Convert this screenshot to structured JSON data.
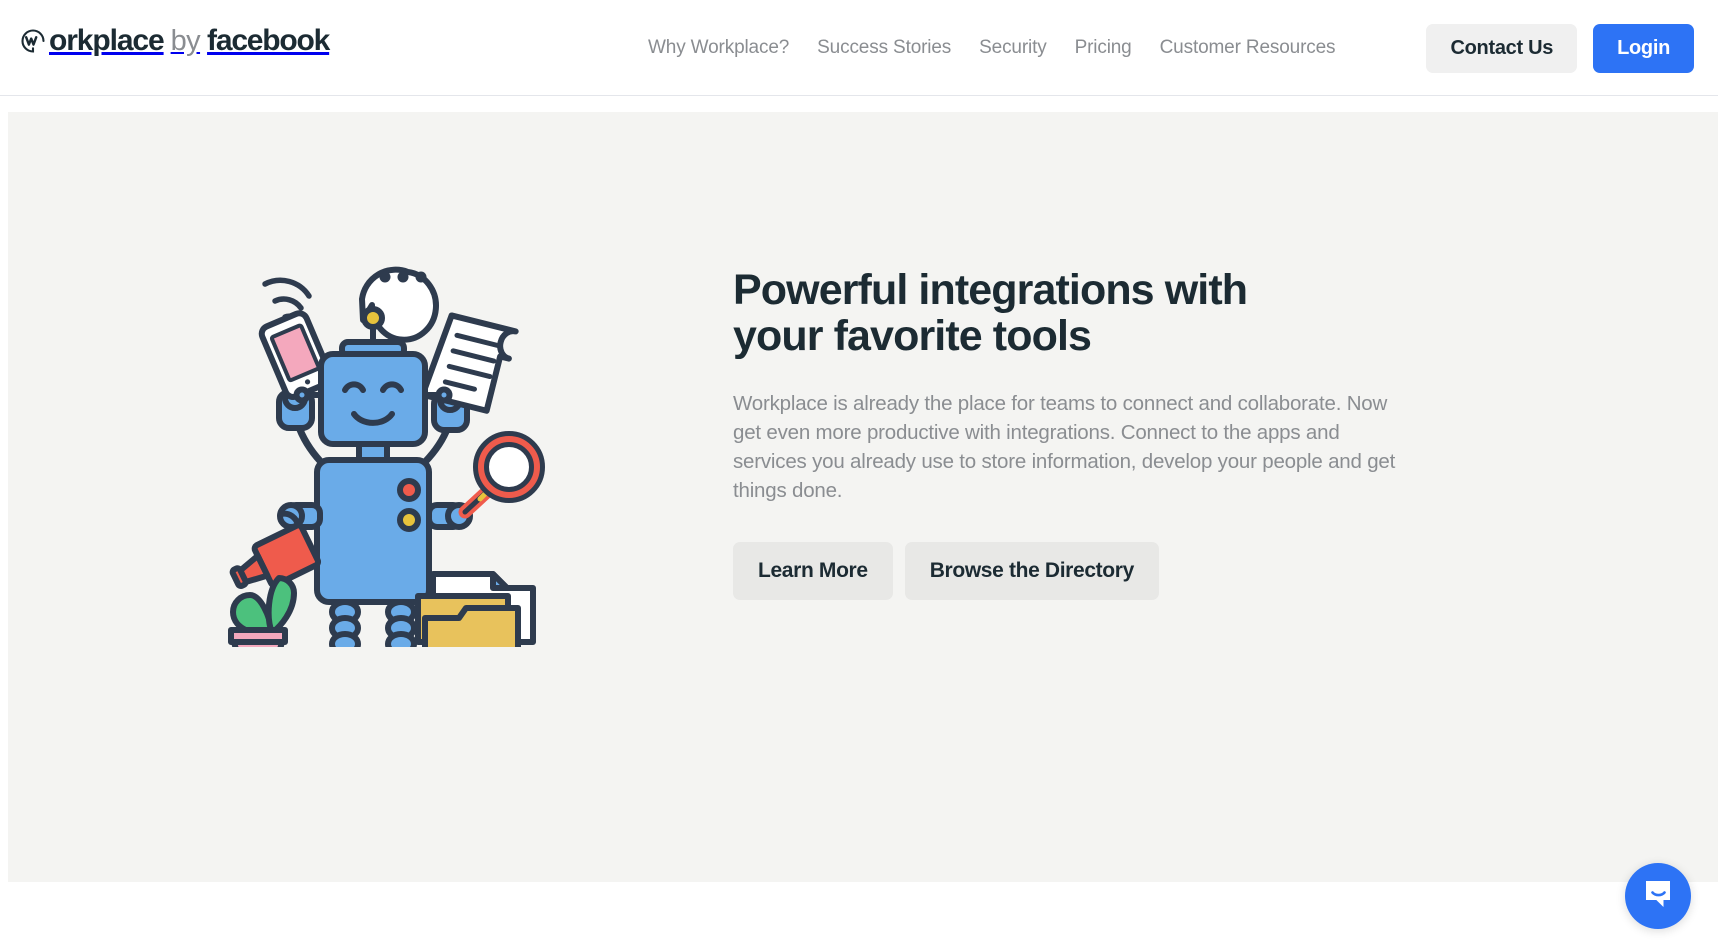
{
  "header": {
    "brand": {
      "logo_icon": "workplace-w-circle-icon",
      "word_workplace": "orkplace",
      "word_by": "by",
      "word_facebook": "facebook",
      "full_text": "Workplace by facebook"
    },
    "nav_items": [
      {
        "label": "Why Workplace?",
        "name": "nav-why-workplace"
      },
      {
        "label": "Success Stories",
        "name": "nav-success-stories"
      },
      {
        "label": "Security",
        "name": "nav-security"
      },
      {
        "label": "Pricing",
        "name": "nav-pricing"
      },
      {
        "label": "Customer Resources",
        "name": "nav-customer-resources"
      }
    ],
    "contact_label": "Contact Us",
    "login_label": "Login",
    "colors": {
      "login_bg": "#2d73f5",
      "contact_bg": "#f0f0f0",
      "nav_text": "#8a8d91",
      "brand_text": "#1c2b33",
      "header_bg": "#ffffff",
      "header_border": "#e4e6eb"
    }
  },
  "hero": {
    "title": "Powerful integrations with\nyour favorite tools",
    "body": "Workplace is already the place for teams to connect and collaborate. Now get even more productive with integrations. Connect to the apps and services you already use to store information, develop your people and get things done.",
    "buttons": [
      {
        "label": "Learn More",
        "name": "learn-more-button"
      },
      {
        "label": "Browse the Directory",
        "name": "browse-directory-button"
      }
    ],
    "background_color": "#f4f4f2",
    "illustration": {
      "name": "robot-integrations-illustration",
      "description": "Blue four-armed robot holding a smartphone, a scroll document and a magnifying glass, watering a potted plant, with a speech bubble above, a folder with papers beside it",
      "colors": {
        "robot_body": "#6aabe8",
        "outline": "#2e3b4e",
        "accent_red": "#ef5b4c",
        "accent_yellow": "#e8c33c",
        "accent_pink": "#f4a8bd",
        "accent_green": "#4cc17d",
        "paper_white": "#ffffff",
        "folder_yellow": "#e8c25c"
      }
    }
  },
  "widgets": {
    "intercom": {
      "name": "intercom-messenger-button",
      "icon": "chat-smile-icon",
      "color": "#2d73f5"
    }
  }
}
